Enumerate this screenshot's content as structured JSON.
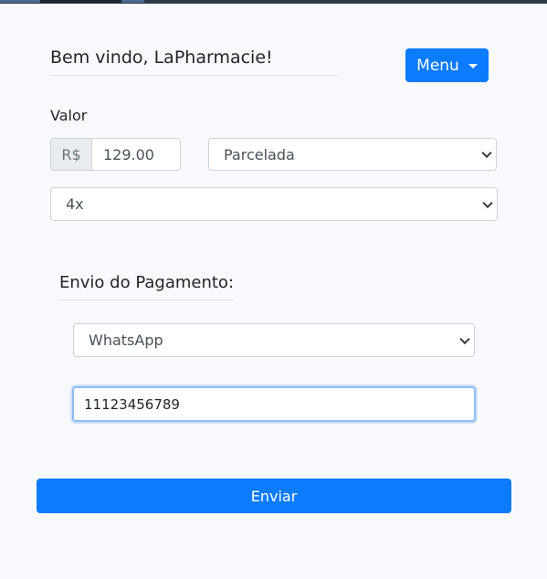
{
  "header": {
    "greeting": "Bem vindo, LaPharmacie!",
    "menu_label": "Menu"
  },
  "payment": {
    "valor_label": "Valor",
    "currency_prefix": "R$",
    "amount_value": "129.00",
    "type_selected": "Parcelada",
    "installments_selected": "4x"
  },
  "delivery": {
    "title": "Envio do Pagamento:",
    "channel_selected": "WhatsApp",
    "phone_value": "11123456789"
  },
  "actions": {
    "submit_label": "Enviar"
  },
  "colors": {
    "primary": "#0b7bff",
    "background": "#f8f9fc",
    "focus_border": "#8dbbf5"
  }
}
